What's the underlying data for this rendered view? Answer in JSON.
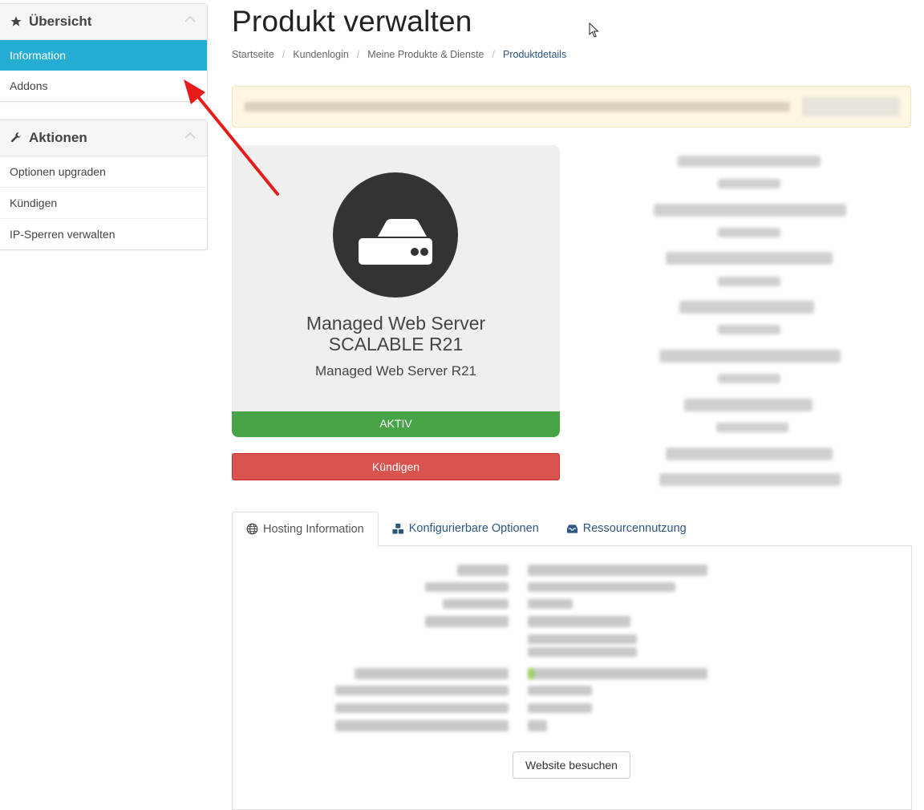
{
  "sidebar": {
    "overview": {
      "title": "Übersicht",
      "items": [
        {
          "label": "Information",
          "active": true
        },
        {
          "label": "Addons",
          "active": false
        }
      ]
    },
    "actions": {
      "title": "Aktionen",
      "items": [
        {
          "label": "Optionen upgraden"
        },
        {
          "label": "Kündigen"
        },
        {
          "label": "IP-Sperren verwalten"
        }
      ]
    }
  },
  "page": {
    "title": "Produkt verwalten",
    "breadcrumb": [
      "Startseite",
      "Kundenlogin",
      "Meine Produkte & Dienste",
      "Produktdetails"
    ]
  },
  "product": {
    "name_line1": "Managed Web Server",
    "name_line2": "SCALABLE R21",
    "group": "Managed Web Server R21",
    "status": "AKTIV",
    "cancel_label": "Kündigen",
    "icon": "server-icon"
  },
  "tabs": [
    {
      "label": "Hosting Information",
      "icon": "globe-icon",
      "active": true
    },
    {
      "label": "Konfigurierbare Optionen",
      "icon": "cubes-icon",
      "active": false
    },
    {
      "label": "Ressourcennutzung",
      "icon": "inbox-icon",
      "active": false
    }
  ],
  "hosting": {
    "visit_label": "Website besuchen"
  },
  "colors": {
    "accent": "#25aed3",
    "status_active": "#46a346",
    "danger": "#d9534f",
    "link": "#2c5680"
  }
}
